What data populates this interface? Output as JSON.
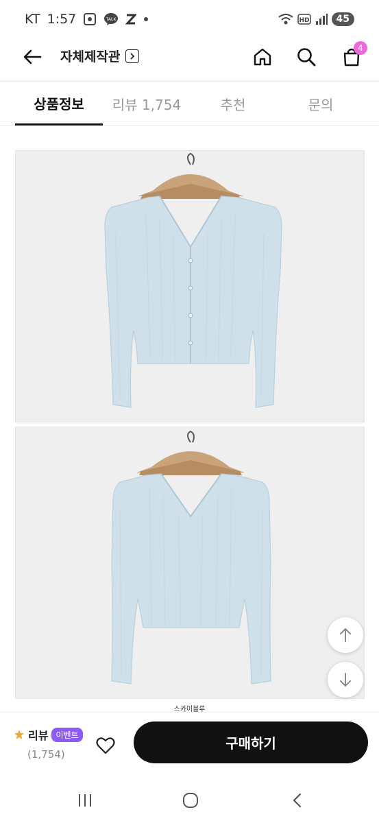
{
  "status_bar": {
    "carrier": "KT",
    "time": "1:57",
    "battery": "45",
    "icons": [
      "screenshot-icon",
      "kakaotalk-icon",
      "z-app-icon",
      "dot-icon",
      "wifi-icon",
      "hd-icon",
      "signal-icon"
    ]
  },
  "header": {
    "store_name": "자체제작관",
    "cart_count": "4",
    "icons": [
      "back-arrow-icon",
      "chevron-right-icon",
      "home-icon",
      "search-icon",
      "cart-icon"
    ]
  },
  "tabs": [
    {
      "label": "상품정보",
      "active": true
    },
    {
      "label": "리뷰 1,754",
      "active": false
    },
    {
      "label": "추천",
      "active": false
    },
    {
      "label": "문의",
      "active": false
    }
  ],
  "images": {
    "caption": "스카이블루",
    "garment_color": "#cfe0ea"
  },
  "buy_bar": {
    "review_label": "리뷰",
    "event_label": "이벤트",
    "review_count": "(1,754)",
    "buy_label": "구매하기"
  },
  "colors": {
    "accent_badge": "#e86cd8",
    "event_badge": "#8b5cf6",
    "star": "#f2a735",
    "buy_button": "#111111"
  }
}
